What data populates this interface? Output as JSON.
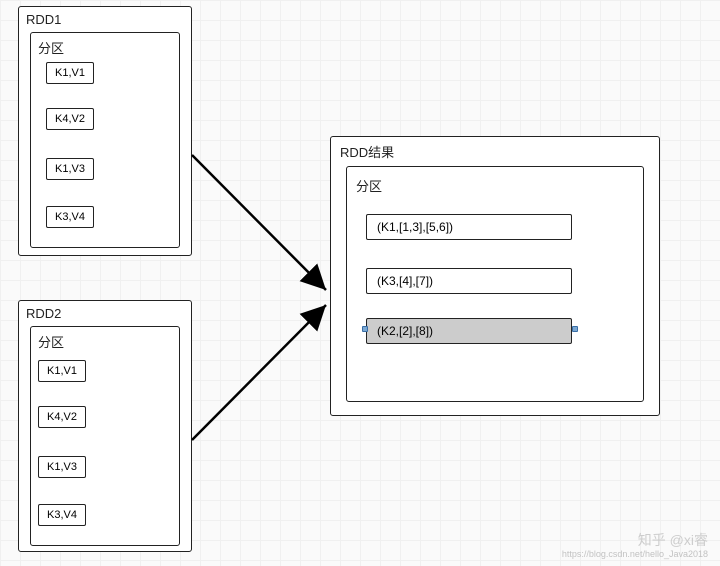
{
  "rdd1": {
    "title": "RDD1",
    "partition_label": "分区",
    "items": [
      "K1,V1",
      "K4,V2",
      "K1,V3",
      "K3,V4"
    ]
  },
  "rdd2": {
    "title": "RDD2",
    "partition_label": "分区",
    "items": [
      "K1,V1",
      "K4,V2",
      "K1,V3",
      "K3,V4"
    ]
  },
  "result": {
    "title": "RDD结果",
    "partition_label": "分区",
    "items": [
      {
        "text": "(K1,[1,3],[5,6])",
        "selected": false
      },
      {
        "text": "(K3,[4],[7])",
        "selected": false
      },
      {
        "text": "(K2,[2],[8])",
        "selected": true
      }
    ]
  },
  "watermark": {
    "main": "知乎 @xi睿",
    "sub": "https://blog.csdn.net/hello_Java2018"
  }
}
